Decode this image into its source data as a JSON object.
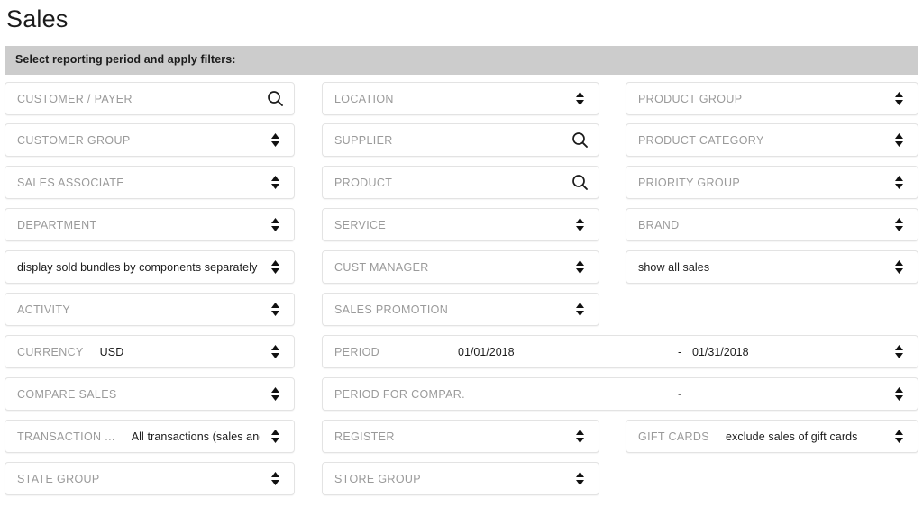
{
  "page": {
    "title": "Sales"
  },
  "filter_bar": {
    "instruction": "Select reporting period and apply filters:",
    "background": "#cccccc"
  },
  "icons": {
    "search": "search-icon",
    "spinner": "updown-spinner-icon"
  },
  "columns": {
    "column1": [
      {
        "label": "CUSTOMER / PAYER",
        "value": "",
        "icon": "search"
      },
      {
        "label": "CUSTOMER GROUP",
        "value": "",
        "icon": "spinner"
      },
      {
        "label": "SALES ASSOCIATE",
        "value": "",
        "icon": "spinner"
      },
      {
        "label": "DEPARTMENT",
        "value": "",
        "icon": "spinner"
      },
      {
        "label": "",
        "value": "display sold bundles by components separately",
        "icon": "spinner"
      },
      {
        "label": "ACTIVITY",
        "value": "",
        "icon": "spinner"
      },
      {
        "label": "CURRENCY",
        "value": "USD",
        "icon": "spinner"
      },
      {
        "label": "COMPARE SALES",
        "value": "",
        "icon": "spinner"
      },
      {
        "label": "TRANSACTION ...",
        "value": "All transactions (sales and returns)",
        "icon": "spinner"
      },
      {
        "label": "STATE GROUP",
        "value": "",
        "icon": "spinner"
      }
    ],
    "column2": [
      {
        "label": "LOCATION",
        "value": "",
        "icon": "spinner"
      },
      {
        "label": "SUPPLIER",
        "value": "",
        "icon": "search"
      },
      {
        "label": "PRODUCT",
        "value": "",
        "icon": "search"
      },
      {
        "label": "SERVICE",
        "value": "",
        "icon": "spinner"
      },
      {
        "label": "CUST MANAGER",
        "value": "",
        "icon": "spinner"
      },
      {
        "label": "SALES PROMOTION",
        "value": "",
        "icon": "spinner"
      },
      {
        "label": "REGISTER",
        "value": "",
        "icon": "spinner"
      },
      {
        "label": "STORE GROUP",
        "value": "",
        "icon": "spinner"
      }
    ],
    "column3": [
      {
        "label": "PRODUCT GROUP",
        "value": "",
        "icon": "spinner"
      },
      {
        "label": "PRODUCT CATEGORY",
        "value": "",
        "icon": "spinner"
      },
      {
        "label": "PRIORITY GROUP",
        "value": "",
        "icon": "spinner"
      },
      {
        "label": "BRAND",
        "value": "",
        "icon": "spinner"
      },
      {
        "label": "",
        "value": "show all sales",
        "icon": "spinner"
      },
      {
        "label": "GIFT CARDS",
        "value": "exclude sales of gift cards",
        "icon": "spinner"
      }
    ],
    "wide": [
      {
        "label": "PERIOD",
        "date_from": "01/01/2018",
        "separator": "-",
        "date_to": "01/31/2018",
        "icon": "spinner"
      },
      {
        "label": "PERIOD FOR COMPAR.",
        "date_from": "",
        "separator": "-",
        "date_to": "",
        "icon": "spinner"
      }
    ]
  }
}
